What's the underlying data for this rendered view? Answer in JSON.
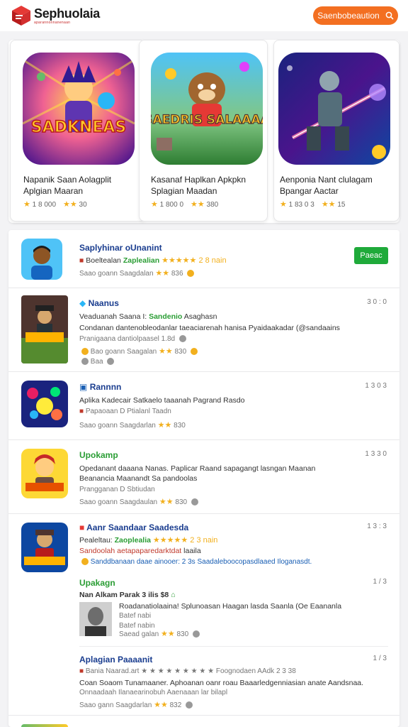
{
  "header": {
    "logo_title": "Sephuolaia",
    "logo_sub": "aparannonnanenaan",
    "search_label": "Saenbobeaution"
  },
  "featured": [
    {
      "art_text": "SADKNEAS",
      "name": "Napanik Saan Aolagplit Aplgian Maaran",
      "downloads": "1 8 000",
      "rating": "30"
    },
    {
      "art_text": "SAEDRIS SALAAAA",
      "name": "Kasanaf Haplkan Apkpkn Splagian Maadan",
      "downloads": "1 800 0",
      "rating": "380"
    },
    {
      "art_text": "",
      "name": "Aenponia Nant clulagam Bpangar Aactar",
      "downloads": "1 83 0 3",
      "rating": "15"
    }
  ],
  "list": [
    {
      "title": "Saplyhinar oUnanint",
      "line1_prefix": "Boeltealan",
      "line1_hl": "Zaplealian",
      "line1_suffix": "★★★★★ 2 8 nain",
      "line2": "Saao goann Saagdalan",
      "line2_rating": "836",
      "button": "Paeac"
    },
    {
      "title": "Naanus",
      "date": "3 0 : 0",
      "line1_prefix": "Veaduanah Saana I:",
      "line1_hl": "Sandenio",
      "line1_suffix": "Asaghasn",
      "line2": "Condanan dantenobleodanlar taeaciarenah hanisa Pyaidaakadar (@sandaains",
      "line3": "Pranigaana dantiolpaasel   1.8d",
      "line4": "Bao goann Saagalan",
      "line4_rating": "830",
      "line5": "Baa"
    },
    {
      "title": "Rannnn",
      "date": "1 3 0 3",
      "line1": "Aplika Kadecair Satkaelo taaanah Pagrand   Rasdo",
      "line2": "Papaoaan D Ptialanl   Taadn",
      "line3": "Saao goann Saagdarlan",
      "line3_rating": "830"
    },
    {
      "title": "Upokamp",
      "date": "1 3 3 0",
      "line1": "Opedanant daaana Nanas. Paplicar Raand sapagangt lasngan Maanan",
      "line2": "Beanancia   Maanandt   Sa pandoolas",
      "line3": "Prangganan   D Sbtiudan",
      "line4": "Saao goann Saagdaulan",
      "line4_rating": "830"
    },
    {
      "title": "Aanr Saandaar Saadesda",
      "date": "1 3 : 3",
      "line1_prefix": "Pealeltau:",
      "line1_hl": "Zaoplealia",
      "line1_suffix": "★★★★★ 2 3 nain",
      "line2_prefix": "Sandoolah",
      "line2_hl": "aetapaparedarktdat",
      "line2_suffix": "laaila",
      "line3": "Sanddbanaan daae ainooer:   2 3s   Saadaleboocopasdlaaed Iloganasdt.",
      "sub1_title": "Upakagn",
      "sub1_date": "1 / 3",
      "sub1_line1": "Nan Alkam Parak 3 ilis  $8",
      "sub1_line2": "Roadanatiolaaina! Splunoasan Haagan lasda Saanla (Oe Eaananla",
      "sub1_line3": "Batef nabi",
      "sub1_line4": "Batef nabin",
      "sub1_line5": "Saead galan",
      "sub1_rating": "830",
      "sub2_title": "Aplagian Paaaanit",
      "sub2_date": "1 / 3",
      "sub2_line1": "Bania Naarad.art ★ ★ ★ ★ ★ ★ ★ ★ ★ Foognodaen AAdk 2 3 38",
      "sub2_line2": "Coan Soaom Tunamaaner. Aphoanan oanr roau Baaarledgenniasian anate Aandsnaa.",
      "sub2_line3": "Onnaadaah Ilanaearinobuh Aaenaaan lar bilapl",
      "sub2_line4": "Saao gann Saagdarlan",
      "sub2_rating": "832"
    }
  ],
  "colors": {
    "accent": "#f36f21",
    "install_green": "#1faa3a",
    "title_blue": "#1a3d8f",
    "title_green": "#2a9d34",
    "star": "#f2b01e"
  }
}
